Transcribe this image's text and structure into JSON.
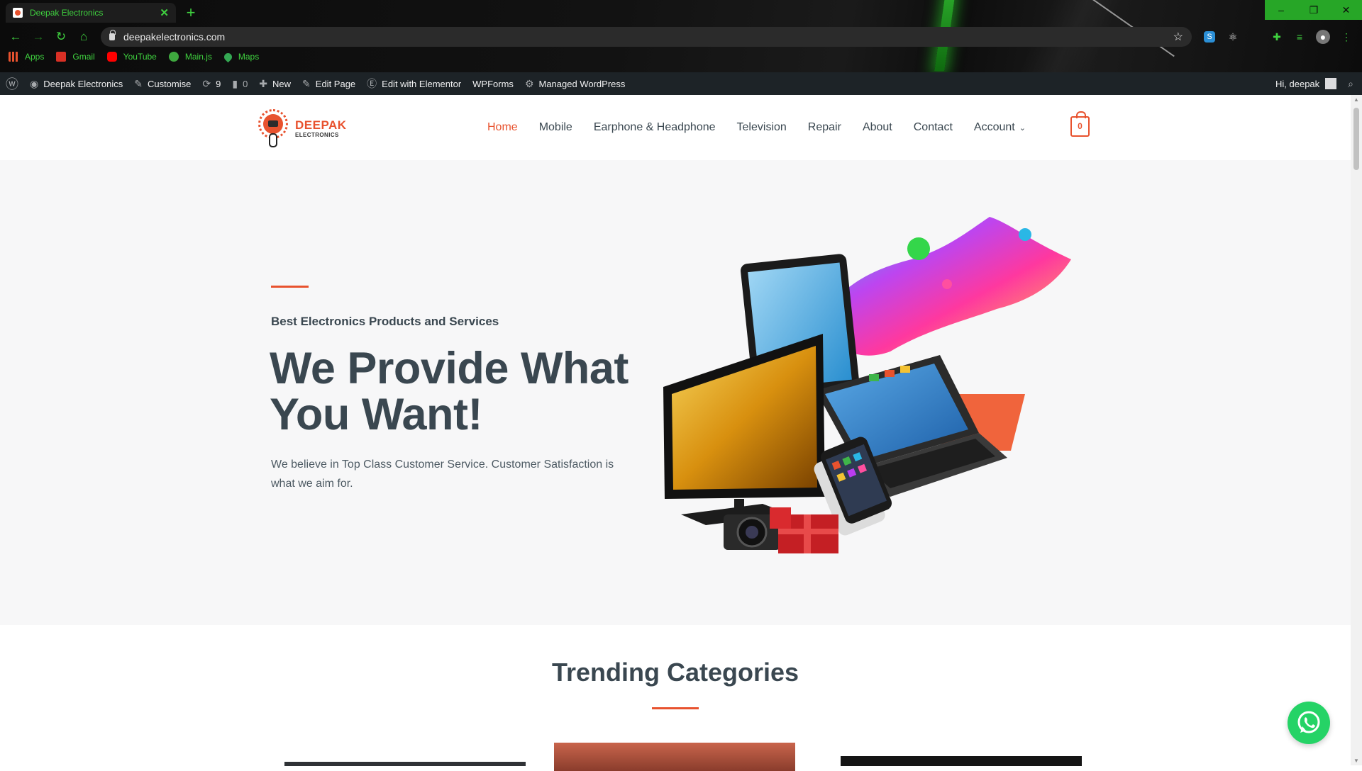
{
  "browser": {
    "tab_title": "Deepak Electronics",
    "tab_close": "✕",
    "new_tab": "+",
    "url": "deepakelectronics.com",
    "window_controls": {
      "minimize": "–",
      "restore": "❐",
      "close": "✕"
    },
    "bookmarks": [
      "Apps",
      "Gmail",
      "YouTube",
      "Main.js",
      "Maps"
    ],
    "accent_color": "#3fd13f"
  },
  "admin_bar": {
    "site_name": "Deepak Electronics",
    "customise": "Customise",
    "updates_count": "9",
    "comments_count": "0",
    "new": "New",
    "edit_page": "Edit Page",
    "edit_elementor": "Edit with Elementor",
    "wpforms": "WPForms",
    "managed_wp": "Managed WordPress",
    "greeting": "Hi, deepak"
  },
  "site": {
    "logo_line1": "DEEPAK",
    "logo_line2": "ELECTRONICS",
    "nav": [
      "Home",
      "Mobile",
      "Earphone & Headphone",
      "Television",
      "Repair",
      "About",
      "Contact",
      "Account"
    ],
    "active_nav": "Home",
    "cart_count": "0",
    "brand_color": "#e8522e"
  },
  "hero": {
    "subtitle": "Best Electronics Products and Services",
    "title": "We Provide What You Want!",
    "description": "We believe in Top Class Customer Service. Customer Satisfaction is what we aim for."
  },
  "trending": {
    "title": "Trending Categories"
  }
}
